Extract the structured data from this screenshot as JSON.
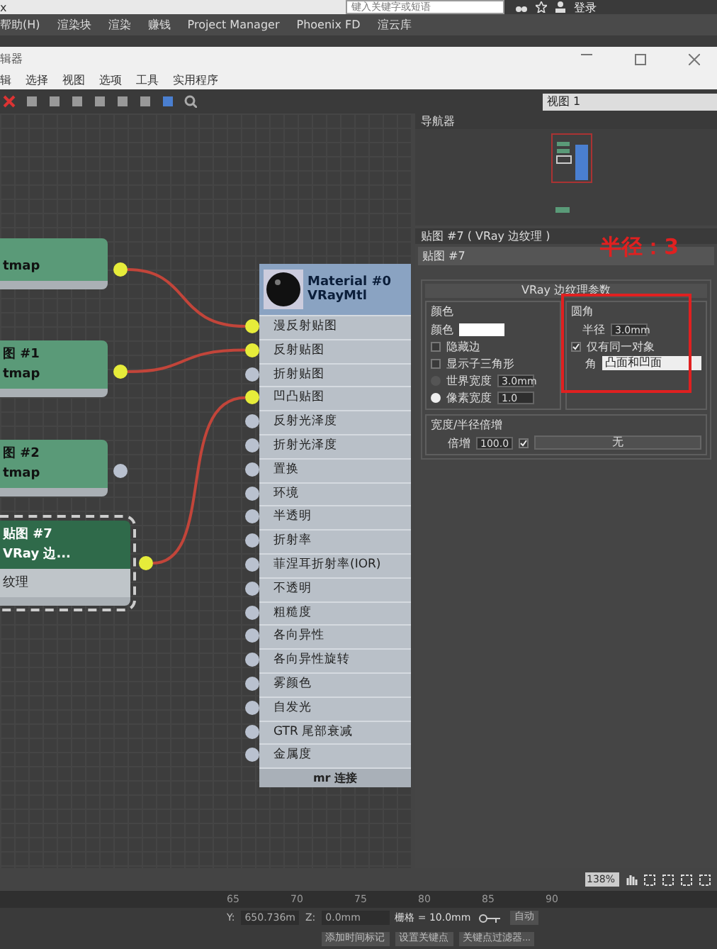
{
  "app_bar": {
    "tab_text": "x",
    "search": {
      "placeholder": "键入关键字或短语"
    },
    "sign_in": "登录"
  },
  "main_menu": [
    "帮助(H)",
    "渲染块",
    "渲染",
    "赚钱",
    "Project Manager",
    "Phoenix FD",
    "渲云库"
  ],
  "window": {
    "title": "辑器",
    "menu": [
      "辑",
      "选择",
      "视图",
      "选项",
      "工具",
      "实用程序"
    ],
    "view_select": "视图 1"
  },
  "canvas": {
    "nodes": [
      {
        "lines": [
          "tmap"
        ],
        "selected": false,
        "connected": true
      },
      {
        "lines": [
          "图 #1",
          "tmap"
        ],
        "selected": false,
        "connected": true
      },
      {
        "lines": [
          "图 #2",
          "tmap"
        ],
        "selected": false,
        "connected": false
      },
      {
        "lines": [
          "贴图 #7",
          "VRay 边..."
        ],
        "body": "纹理",
        "selected": true,
        "connected": true
      }
    ],
    "material": {
      "name": "Material #0",
      "type": "VRayMtl",
      "footer": "mr 连接",
      "slots": [
        {
          "label": "漫反射贴图",
          "connected": true
        },
        {
          "label": "反射贴图",
          "connected": true
        },
        {
          "label": "折射贴图",
          "connected": false
        },
        {
          "label": "凹凸贴图",
          "connected": true
        },
        {
          "label": "反射光泽度",
          "connected": false
        },
        {
          "label": "折射光泽度",
          "connected": false
        },
        {
          "label": "置换",
          "connected": false
        },
        {
          "label": "环境",
          "connected": false
        },
        {
          "label": "半透明",
          "connected": false
        },
        {
          "label": "折射率",
          "connected": false
        },
        {
          "label": "菲涅耳折射率(IOR)",
          "connected": false
        },
        {
          "label": "不透明",
          "connected": false
        },
        {
          "label": "粗糙度",
          "connected": false
        },
        {
          "label": "各向异性",
          "connected": false
        },
        {
          "label": "各向异性旋转",
          "connected": false
        },
        {
          "label": "雾颜色",
          "connected": false
        },
        {
          "label": "自发光",
          "connected": false
        },
        {
          "label": "GTR 尾部衰减",
          "connected": false
        },
        {
          "label": "金属度",
          "connected": false
        }
      ]
    }
  },
  "navigator": {
    "title": "导航器"
  },
  "params": {
    "title": "贴图 #7 ( VRay 边纹理 )",
    "name": "贴图 #7",
    "rollout": "VRay 边纹理参数",
    "color_group": {
      "legend": "颜色",
      "color_label": "颜色",
      "hide_edges": {
        "label": "隐藏边",
        "checked": false
      },
      "show_subtriangles": {
        "label": "显示子三角形",
        "checked": false
      },
      "world_width": {
        "label": "世界宽度",
        "value": "3.0mm",
        "selected": false
      },
      "pixel_width": {
        "label": "像素宽度",
        "value": "1.0",
        "selected": true
      }
    },
    "round_group": {
      "legend": "圆角",
      "radius_label": "半径",
      "radius": "3.0mm",
      "same_object": {
        "label": "仅有同一对象",
        "checked": true
      },
      "corner_label": "角",
      "corner": "凸面和凹面"
    },
    "mult_group": {
      "legend": "宽度/半径倍增",
      "mult_label": "倍增",
      "mult": "100.0",
      "enabled": {
        "checked": true
      },
      "map_button": "无"
    }
  },
  "annotation": "半径：3",
  "zoom": "138%",
  "timeline": {
    "ticks": [
      "65",
      "70",
      "75",
      "80",
      "85",
      "90"
    ]
  },
  "status": {
    "y_label": "Y:",
    "y": "650.736m",
    "z_label": "Z:",
    "z": "0.0mm",
    "grid": "栅格 = 10.0mm",
    "add_tag": "添加时间标记",
    "auto_key": "自动",
    "set_key": "设置关键点",
    "key_filter": "关键点过滤器..."
  }
}
